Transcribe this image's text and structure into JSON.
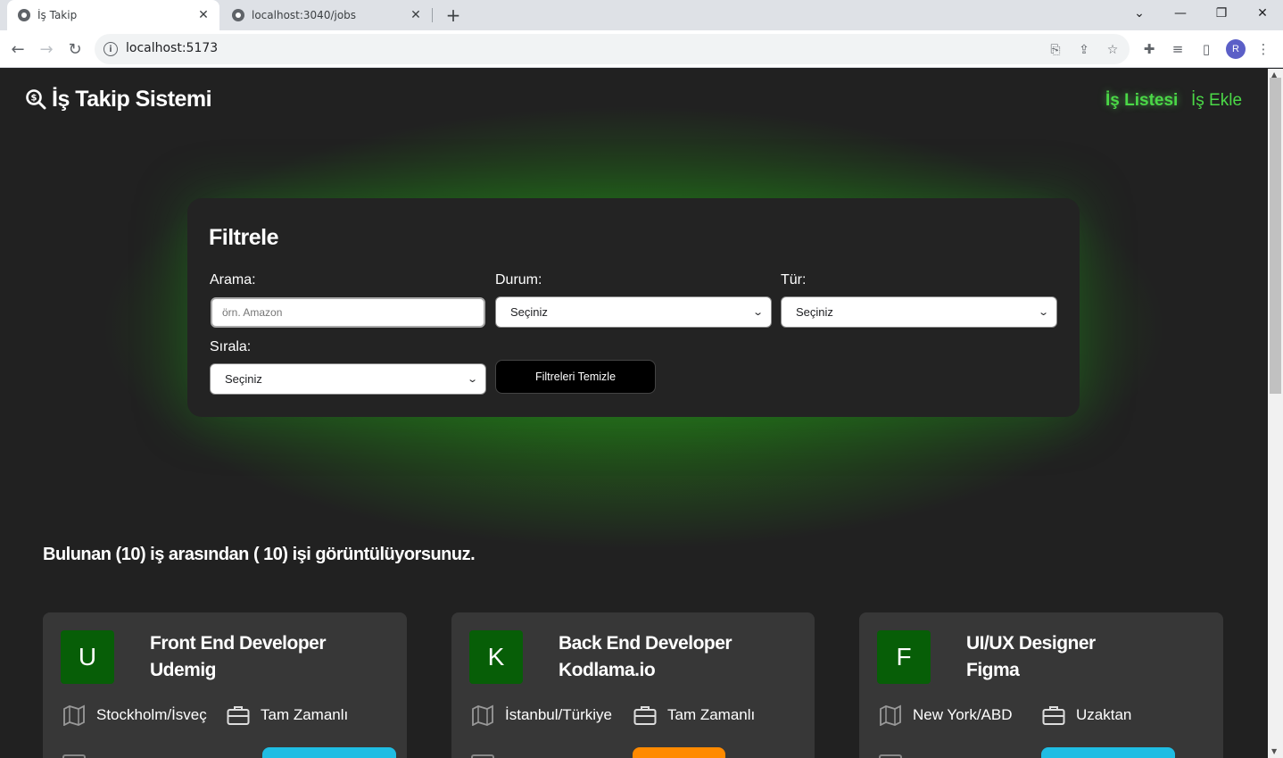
{
  "browser": {
    "tabs": [
      {
        "title": "İş Takip",
        "active": true
      },
      {
        "title": "localhost:3040/jobs",
        "active": false
      }
    ],
    "url": "localhost:5173",
    "profile_initial": "R"
  },
  "app": {
    "title": "İş Takip Sistemi",
    "nav": [
      {
        "label": "İş Listesi",
        "active": true
      },
      {
        "label": "İş Ekle",
        "active": false
      }
    ]
  },
  "filter": {
    "heading": "Filtrele",
    "search": {
      "label": "Arama:",
      "placeholder": "örn. Amazon"
    },
    "status": {
      "label": "Durum:",
      "selected": "Seçiniz"
    },
    "type": {
      "label": "Tür:",
      "selected": "Seçiniz"
    },
    "sort": {
      "label": "Sırala:",
      "selected": "Seçiniz"
    },
    "clear_label": "Filtreleri Temizle"
  },
  "summary": "Bulunan (10) iş arasından ( 10) işi görüntülüyorsunuz.",
  "jobs": [
    {
      "letter": "U",
      "position": "Front End Developer",
      "company": "Udemig",
      "location": "Stockholm/İsveç",
      "type": "Tam Zamanlı",
      "status_color": "#1fbde3"
    },
    {
      "letter": "K",
      "position": "Back End Developer",
      "company": "Kodlama.io",
      "location": "İstanbul/Türkiye",
      "type": "Tam Zamanlı",
      "status_color": "#ff8a00"
    },
    {
      "letter": "F",
      "position": "UI/UX Designer",
      "company": "Figma",
      "location": "New York/ABD",
      "type": "Uzaktan",
      "status_color": "#1fbde3"
    }
  ],
  "colors": {
    "accent_green": "#4bd847",
    "company_tile": "#075e07"
  }
}
